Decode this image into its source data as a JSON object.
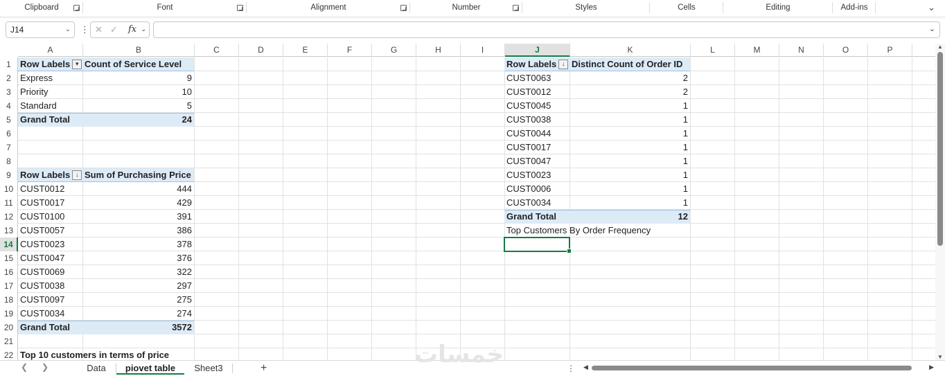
{
  "ribbon": {
    "groups": [
      "Clipboard",
      "Font",
      "Alignment",
      "Number",
      "Styles",
      "Cells",
      "Editing",
      "Add-ins"
    ],
    "collapse_icon": "chevron-down-icon"
  },
  "formula_bar": {
    "name_box": "J14",
    "fx_label": "fx",
    "formula_value": ""
  },
  "columns": [
    "A",
    "B",
    "C",
    "D",
    "E",
    "F",
    "G",
    "H",
    "I",
    "J",
    "K",
    "L",
    "M",
    "N",
    "O",
    "P"
  ],
  "selected_column": "J",
  "rows": [
    "1",
    "2",
    "3",
    "4",
    "5",
    "6",
    "7",
    "8",
    "9",
    "10",
    "11",
    "12",
    "13",
    "14",
    "15",
    "16",
    "17",
    "18",
    "19",
    "20",
    "21",
    "22"
  ],
  "selected_row": "14",
  "pivot1": {
    "row_labels": "Row Labels",
    "value_header": "Count of Service Level",
    "items": [
      {
        "label": "Express",
        "value": "9"
      },
      {
        "label": "Priority",
        "value": "10"
      },
      {
        "label": "Standard",
        "value": "5"
      }
    ],
    "total_label": "Grand Total",
    "total_value": "24"
  },
  "pivot2": {
    "row_labels": "Row Labels",
    "value_header": "Sum of Purchasing Price",
    "items": [
      {
        "label": "CUST0012",
        "value": "444"
      },
      {
        "label": "CUST0017",
        "value": "429"
      },
      {
        "label": "CUST0100",
        "value": "391"
      },
      {
        "label": "CUST0057",
        "value": "386"
      },
      {
        "label": "CUST0023",
        "value": "378"
      },
      {
        "label": "CUST0047",
        "value": "376"
      },
      {
        "label": "CUST0069",
        "value": "322"
      },
      {
        "label": "CUST0038",
        "value": "297"
      },
      {
        "label": "CUST0097",
        "value": "275"
      },
      {
        "label": "CUST0034",
        "value": "274"
      }
    ],
    "total_label": "Grand Total",
    "total_value": "3572",
    "caption": "Top 10 customers in terms of price"
  },
  "pivot3": {
    "row_labels": "Row Labels",
    "value_header": "Distinct Count of Order ID",
    "items": [
      {
        "label": "CUST0063",
        "value": "2"
      },
      {
        "label": "CUST0012",
        "value": "2"
      },
      {
        "label": "CUST0045",
        "value": "1"
      },
      {
        "label": "CUST0038",
        "value": "1"
      },
      {
        "label": "CUST0044",
        "value": "1"
      },
      {
        "label": "CUST0017",
        "value": "1"
      },
      {
        "label": "CUST0047",
        "value": "1"
      },
      {
        "label": "CUST0023",
        "value": "1"
      },
      {
        "label": "CUST0006",
        "value": "1"
      },
      {
        "label": "CUST0034",
        "value": "1"
      }
    ],
    "total_label": "Grand Total",
    "total_value": "12",
    "caption": "Top Customers By Order Frequency"
  },
  "sheet_tabs": {
    "tabs": [
      "Data",
      "piovet table",
      "Sheet3"
    ],
    "active": "piovet table",
    "add_label": "+"
  },
  "watermark": "خمسات",
  "colors": {
    "accent": "#107c41",
    "pivot_band": "#ddebf7",
    "pivot_border": "#9bc2e6"
  }
}
